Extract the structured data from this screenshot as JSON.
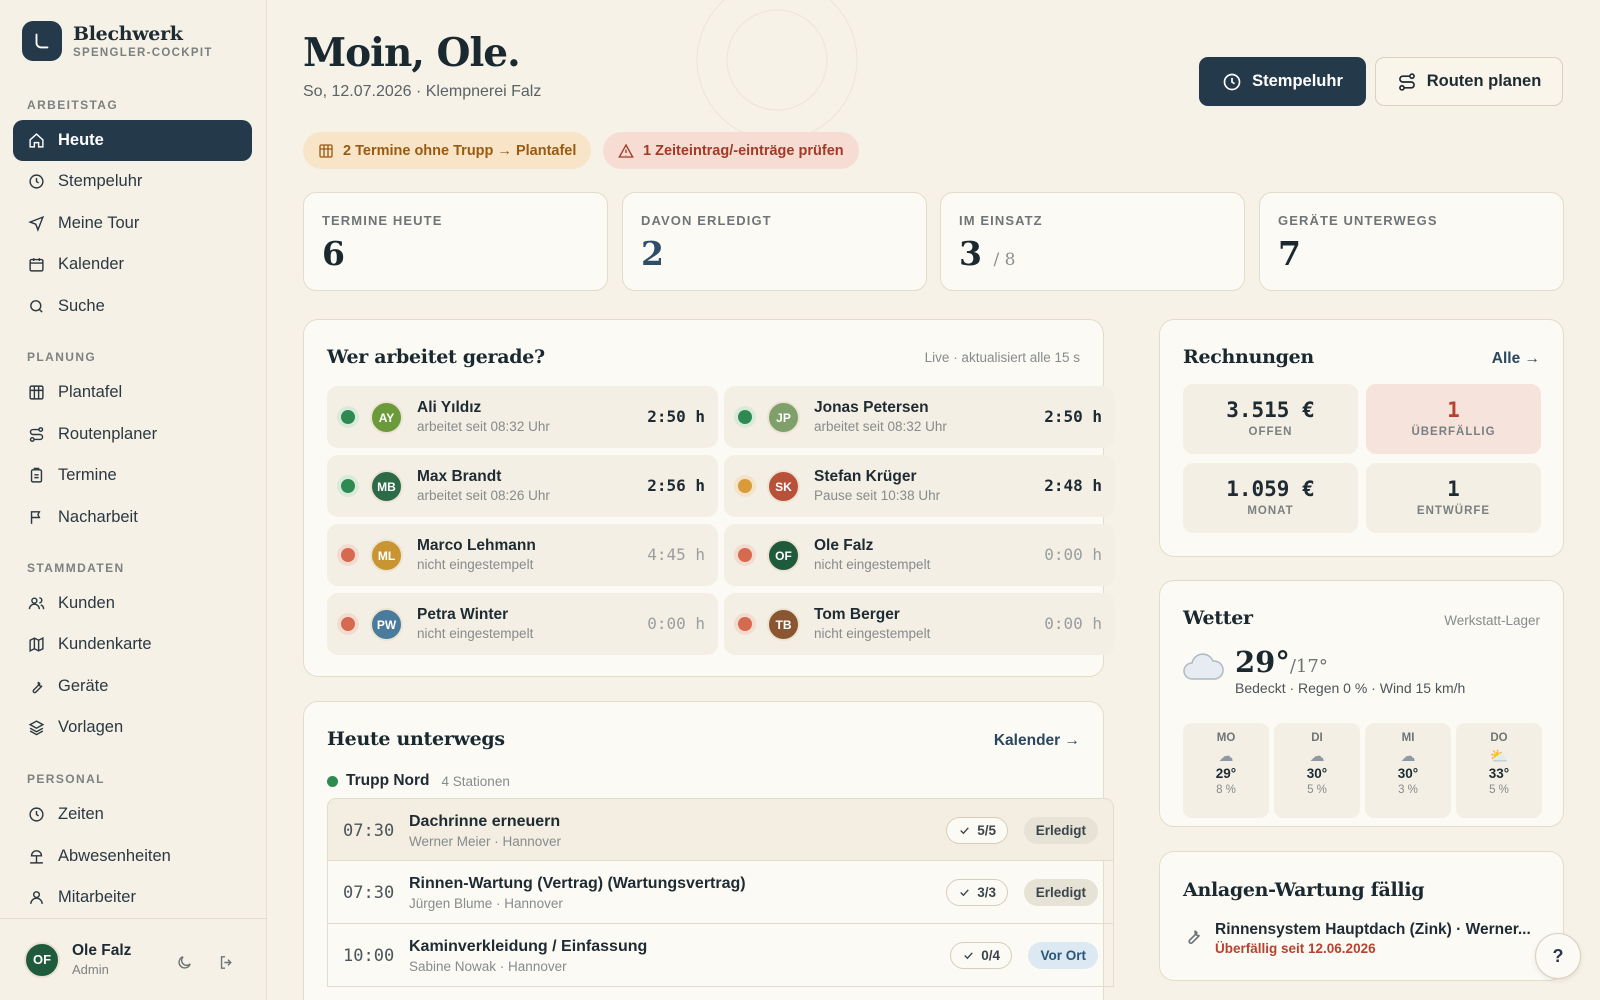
{
  "brand": {
    "name": "Blechwerk",
    "tagline": "SPENGLER-COCKPIT"
  },
  "sidebar": {
    "sections": [
      "ARBEITSTAG",
      "PLANUNG",
      "STAMMDATEN",
      "PERSONAL"
    ],
    "items": [
      {
        "label": "Heute",
        "icon": "home-icon",
        "active": true
      },
      {
        "label": "Stempeluhr",
        "icon": "clock-icon"
      },
      {
        "label": "Meine Tour",
        "icon": "navigation-icon"
      },
      {
        "label": "Kalender",
        "icon": "calendar-icon"
      },
      {
        "label": "Suche",
        "icon": "search-icon"
      },
      {
        "label": "Plantafel",
        "icon": "grid-board-icon"
      },
      {
        "label": "Routenplaner",
        "icon": "route-icon"
      },
      {
        "label": "Termine",
        "icon": "clipboard-icon"
      },
      {
        "label": "Nacharbeit",
        "icon": "flag-icon"
      },
      {
        "label": "Kunden",
        "icon": "users-icon"
      },
      {
        "label": "Kundenkarte",
        "icon": "map-icon"
      },
      {
        "label": "Geräte",
        "icon": "wrench-icon"
      },
      {
        "label": "Vorlagen",
        "icon": "layers-icon"
      },
      {
        "label": "Zeiten",
        "icon": "clock-icon"
      },
      {
        "label": "Abwesenheiten",
        "icon": "beach-icon"
      },
      {
        "label": "Mitarbeiter",
        "icon": "user-icon"
      }
    ],
    "user": {
      "initials": "OF",
      "name": "Ole Falz",
      "role": "Admin"
    }
  },
  "header": {
    "greeting": "Moin, Ole.",
    "subtitle": "So, 12.07.2026 · Klempnerei Falz",
    "btn_clock": "Stempeluhr",
    "btn_routes": "Routen planen"
  },
  "alerts": {
    "unassigned": "2 Termine ohne Trupp → Plantafel",
    "time_check": "1 Zeiteintrag/-einträge prüfen"
  },
  "stats": [
    {
      "label": "TERMINE HEUTE",
      "value": "6"
    },
    {
      "label": "DAVON ERLEDIGT",
      "value": "2"
    },
    {
      "label": "IM EINSATZ",
      "value": "3",
      "suffix": "/ 8"
    },
    {
      "label": "GERÄTE UNTERWEGS",
      "value": "7"
    }
  ],
  "workers": {
    "title": "Wer arbeitet gerade?",
    "live": "Live · aktualisiert alle 15 s",
    "list": [
      {
        "initials": "AY",
        "name": "Ali Yıldız",
        "status": "arbeitet seit 08:32 Uhr",
        "hours": "2:50 h",
        "state": "#2f8a52",
        "avatar": "#6a9a3a"
      },
      {
        "initials": "JP",
        "name": "Jonas Petersen",
        "status": "arbeitet seit 08:32 Uhr",
        "hours": "2:50 h",
        "state": "#2f8a52",
        "avatar": "#7fa06a"
      },
      {
        "initials": "MB",
        "name": "Max Brandt",
        "status": "arbeitet seit 08:26 Uhr",
        "hours": "2:56 h",
        "state": "#2f8a52",
        "avatar": "#2d6b48"
      },
      {
        "initials": "SK",
        "name": "Stefan Krüger",
        "status": "Pause seit 10:38 Uhr",
        "hours": "2:48 h",
        "state": "#d99a3a",
        "avatar": "#b8503a"
      },
      {
        "initials": "ML",
        "name": "Marco Lehmann",
        "status": "nicht eingestempelt",
        "hours": "4:45 h",
        "state": "#d66a4e",
        "avatar": "#c99532"
      },
      {
        "initials": "OF",
        "name": "Ole Falz",
        "status": "nicht eingestempelt",
        "hours": "0:00 h",
        "state": "#d66a4e",
        "avatar": "#1f5a3c"
      },
      {
        "initials": "PW",
        "name": "Petra Winter",
        "status": "nicht eingestempelt",
        "hours": "0:00 h",
        "state": "#d66a4e",
        "avatar": "#4a7a9c"
      },
      {
        "initials": "TB",
        "name": "Tom Berger",
        "status": "nicht eingestempelt",
        "hours": "0:00 h",
        "state": "#d66a4e",
        "avatar": "#8a5632"
      }
    ]
  },
  "invoices": {
    "title": "Rechnungen",
    "link": "Alle →",
    "open": {
      "value": "3.515 €",
      "label": "OFFEN"
    },
    "overdue": {
      "value": "1",
      "label": "ÜBERFÄLLIG"
    },
    "month": {
      "value": "1.059 €",
      "label": "MONAT"
    },
    "drafts": {
      "value": "1",
      "label": "ENTWÜRFE"
    }
  },
  "weather": {
    "title": "Wetter",
    "location": "Werkstatt-Lager",
    "temp": "29°",
    "low": "/17°",
    "desc": "Bedeckt · Regen 0 % · Wind 15 km/h",
    "forecast": [
      {
        "day": "MO",
        "temp": "29°",
        "rain": "8 %",
        "icon": "cloud-icon"
      },
      {
        "day": "DI",
        "temp": "30°",
        "rain": "5 %",
        "icon": "cloud-icon"
      },
      {
        "day": "MI",
        "temp": "30°",
        "rain": "3 %",
        "icon": "cloud-icon"
      },
      {
        "day": "DO",
        "temp": "33°",
        "rain": "5 %",
        "icon": "sun-cloud-icon"
      }
    ]
  },
  "maintenance": {
    "title": "Anlagen-Wartung fällig",
    "item": "Rinnensystem Hauptdach (Zink) · Werner...",
    "due": "Überfällig seit 12.06.2026"
  },
  "today": {
    "title": "Heute unterwegs",
    "link": "Kalender →",
    "team": "Trupp Nord",
    "stations": "4 Stationen",
    "rows": [
      {
        "time": "07:30",
        "title": "Dachrinne erneuern",
        "customer": "Werner Meier · Hannover",
        "count": "5/5",
        "status": "Erledigt",
        "kind": "done"
      },
      {
        "time": "07:30",
        "title": "Rinnen-Wartung (Vertrag) (Wartungsvertrag)",
        "customer": "Jürgen Blume · Hannover",
        "count": "3/3",
        "status": "Erledigt",
        "kind": "done"
      },
      {
        "time": "10:00",
        "title": "Kaminverkleidung / Einfassung",
        "customer": "Sabine Nowak · Hannover",
        "count": "0/4",
        "status": "Vor Ort",
        "kind": "on"
      }
    ]
  },
  "help_label": "?"
}
